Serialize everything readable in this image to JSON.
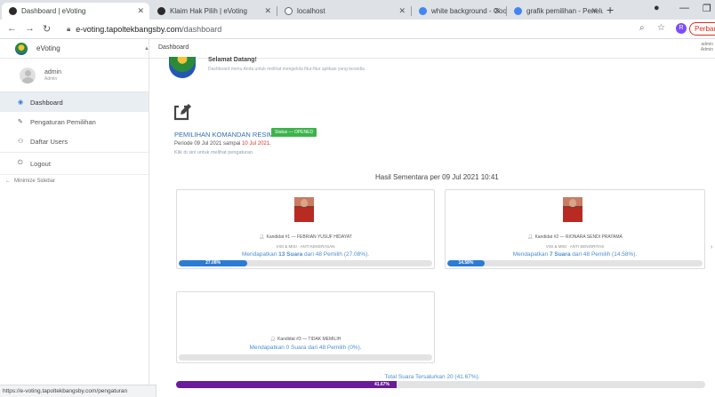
{
  "browser": {
    "tabs": [
      {
        "title": "Dashboard | eVoting",
        "favicon_color": "#2b2b2b"
      },
      {
        "title": "Klaim Hak Pilih | eVoting",
        "favicon_color": "#2b2b2b"
      },
      {
        "title": "localhost",
        "favicon_color": "#5f6368"
      },
      {
        "title": "white background - Google I",
        "favicon_color": "#4285f4"
      },
      {
        "title": "grafik pemilihan - Penelusura",
        "favicon_color": "#4285f4"
      }
    ],
    "new_tab": "+",
    "url_host": "e-voting.tapoltekbangsby.com",
    "url_path": "/dashboard",
    "profile_initial": "R",
    "update_button": "Perbarui",
    "status_url": "https://e-voting.tapoltekbangsby.com/pengaturan"
  },
  "sidebar": {
    "brand": "eVoting",
    "user": {
      "name": "admin",
      "role": "Admin"
    },
    "items": [
      {
        "label": "Dashboard",
        "icon": "dashboard-icon",
        "glyph": "◉",
        "active": true
      },
      {
        "label": "Pengaturan Pemilihan",
        "icon": "wrench-icon",
        "glyph": "✎",
        "active": false
      },
      {
        "label": "Daftar Users",
        "icon": "users-icon",
        "glyph": "⚇",
        "active": false
      }
    ],
    "logout": {
      "label": "Logout",
      "icon": "logout-icon",
      "glyph": "⏻"
    },
    "minimize": "Minimize Sidebar"
  },
  "topbar": {
    "title": "Dashboard",
    "user_name": "admin",
    "user_role": "Admin"
  },
  "welcome": {
    "heading": "Selamat Datang!",
    "text": "Dashboard menu Anda untuk melihat mengelola fitur-fitur aplikasi yang tersedia"
  },
  "election": {
    "title": "PEMILIHAN KOMANDAN RESIMEN",
    "status_badge": "Status — OPENED",
    "period_prefix": "Periode 09 Jul 2021 sampai ",
    "period_end": "10 Jul 2021",
    "period_suffix": ".",
    "hint": "Klik di sini untuk melihat pengaturan"
  },
  "results": {
    "title": "Hasil Sementara per 09 Jul 2021 10:41",
    "candidates": [
      {
        "label": "Kandidat #1 — FEBRIAN YUSUF HIDAYAT",
        "vision": "VISI & MISI · ANTI KEKERASAN",
        "votes_prefix": "Mendapatkan ",
        "votes_bold": "13 Suara",
        "votes_suffix": " dari 48 Pemilih (27.08%).",
        "percent": 27.08,
        "percent_label": "27.08%",
        "has_photo": true
      },
      {
        "label": "Kandidat #2 — RIONARA SENDI PRATAMA",
        "vision": "VISI & MISI · ANTI SENIORITAS",
        "votes_prefix": "Mendapatkan ",
        "votes_bold": "7 Suara",
        "votes_suffix": " dari 48 Pemilih (14.58%).",
        "percent": 14.58,
        "percent_label": "14.58%",
        "has_photo": true
      },
      {
        "label": "Kandidat #3 — TIDAK MEMILIH",
        "vision": "",
        "votes_prefix": "Mendapatkan ",
        "votes_bold": "0 Suara",
        "votes_suffix": " dari 48 Pemilih (0%).",
        "percent": 0,
        "percent_label": "",
        "has_photo": false
      }
    ],
    "total_text": "Total Suara Tersalurkan 20 (41.67%).",
    "total_percent": 41.67,
    "total_label": "41.67%"
  },
  "colors": {
    "accent_blue": "#2b7cd3",
    "total_purple": "#6a1b9a",
    "status_green": "#3cb44b",
    "date_red": "#d9342b"
  }
}
